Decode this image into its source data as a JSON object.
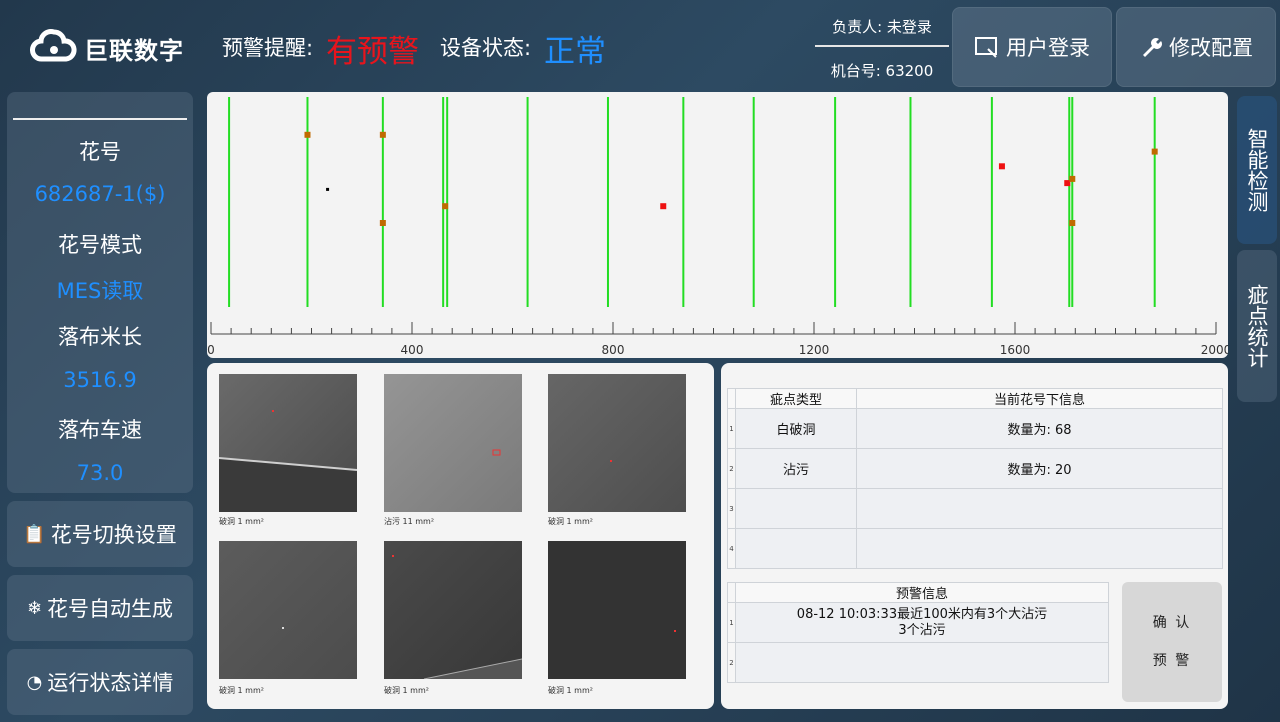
{
  "header": {
    "logo_text": "巨联数字",
    "warn_label": "预警提醒:",
    "warn_value": "有预警",
    "status_label": "设备状态:",
    "status_value": "正常",
    "owner": "负责人: 未登录",
    "machine": "机台号: 63200",
    "login_button": "用户登录",
    "config_button": "修改配置",
    "colors": {
      "warn": "#e8141c",
      "status": "#1f8fff",
      "value": "#1f8fff"
    }
  },
  "left": {
    "pattern_label": "花号",
    "pattern_value": "682687-1($)",
    "mode_label": "花号模式",
    "mode_value": "MES读取",
    "length_label": "落布米长",
    "length_value": "3516.9",
    "speed_label": "落布车速",
    "speed_value": "73.0",
    "buttons": [
      {
        "label": "花号切换设置",
        "icon": "clipboard-icon"
      },
      {
        "label": "花号自动生成",
        "icon": "snowflake-icon"
      },
      {
        "label": "运行状态详情",
        "icon": "pie-chart-icon"
      }
    ]
  },
  "tabs": {
    "detect": "智能检测",
    "stats": "疵点统计"
  },
  "chart_data": {
    "type": "scatter",
    "xlim": [
      0,
      2000
    ],
    "x_ticks": [
      0,
      400,
      800,
      1200,
      1600,
      2000
    ],
    "x_tick_labels": [
      "0",
      "400",
      "800",
      "1200",
      "1600",
      "2000"
    ],
    "vertical_lines": [
      36,
      192,
      342,
      462,
      470,
      630,
      790,
      940,
      1080,
      1242,
      1392,
      1554,
      1708,
      1714,
      1878
    ],
    "points": [
      {
        "x": 192,
        "y": 0.82,
        "kind": "stain"
      },
      {
        "x": 342,
        "y": 0.82,
        "kind": "stain"
      },
      {
        "x": 232,
        "y": 0.56,
        "kind": "dot"
      },
      {
        "x": 466,
        "y": 0.48,
        "kind": "stain"
      },
      {
        "x": 342,
        "y": 0.4,
        "kind": "stain"
      },
      {
        "x": 900,
        "y": 0.48,
        "kind": "hole"
      },
      {
        "x": 1574,
        "y": 0.67,
        "kind": "hole"
      },
      {
        "x": 1704,
        "y": 0.59,
        "kind": "hole"
      },
      {
        "x": 1714,
        "y": 0.61,
        "kind": "stain"
      },
      {
        "x": 1714,
        "y": 0.4,
        "kind": "stain"
      },
      {
        "x": 1878,
        "y": 0.74,
        "kind": "stain"
      }
    ],
    "colors": {
      "line": "#22dd22",
      "hole": "#ee1111",
      "stain": "#c06a00",
      "dot": "#000000"
    }
  },
  "thumbnails": [
    {
      "caption": "破洞 1 mm²",
      "shade": "#5c5c5c"
    },
    {
      "caption": "沾污 11 mm²",
      "shade": "#8a8a8a"
    },
    {
      "caption": "破洞 1 mm²",
      "shade": "#5a5a5a"
    },
    {
      "caption": "破洞 1 mm²",
      "shade": "#545454"
    },
    {
      "caption": "破洞 1 mm²",
      "shade": "#3e3e3e"
    },
    {
      "caption": "破洞 1 mm²",
      "shade": "#2e2e2e"
    }
  ],
  "defect_table": {
    "headers": [
      "疵点类型",
      "当前花号下信息"
    ],
    "row_numbers": [
      "1",
      "2",
      "3",
      "4"
    ],
    "rows": [
      [
        "白破洞",
        "数量为: 68"
      ],
      [
        "沾污",
        "数量为: 20"
      ],
      [
        "",
        ""
      ],
      [
        "",
        ""
      ]
    ]
  },
  "warning_table": {
    "header": "预警信息",
    "row_numbers": [
      "1",
      "2"
    ],
    "rows": [
      "08-12 10:03:33最近100米内有3个大沾污",
      "3个沾污"
    ]
  },
  "confirm_button": {
    "line1": "确 认",
    "line2": "预 警"
  }
}
